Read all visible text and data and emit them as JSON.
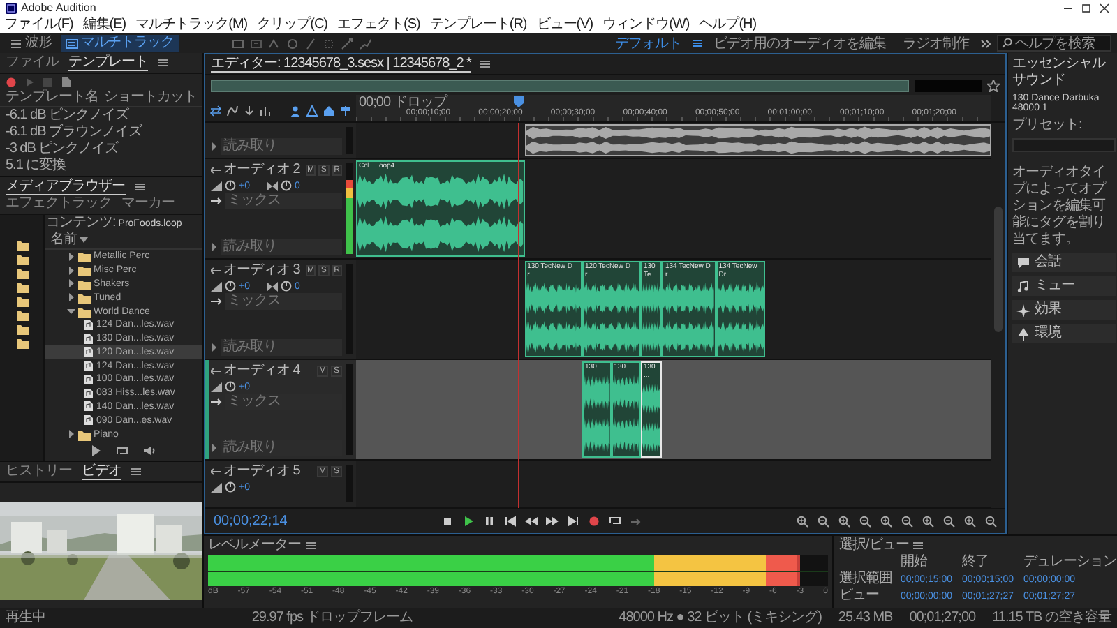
{
  "window": {
    "title": "Adobe Audition"
  },
  "menu": [
    "ファイル(F)",
    "編集(E)",
    "マルチトラック(M)",
    "クリップ(C)",
    "エフェクト(S)",
    "テンプレート(R)",
    "ビュー(V)",
    "ウィンドウ(W)",
    "ヘルプ(H)"
  ],
  "modes": [
    {
      "label": "波形",
      "selected": false
    },
    {
      "label": "マルチトラック",
      "selected": true
    }
  ],
  "workspaces": [
    {
      "label": "デフォルト",
      "selected": true
    },
    {
      "label": "ビデオ用のオーディオを編集",
      "selected": false
    },
    {
      "label": "ラジオ制作",
      "selected": false
    }
  ],
  "help_search": {
    "placeholder": "ヘルプを検索"
  },
  "templates_panel": {
    "tabs": [
      {
        "label": "ファイル",
        "selected": false
      },
      {
        "label": "テンプレート",
        "selected": true
      }
    ],
    "columns": [
      "テンプレート名",
      "ショートカット"
    ],
    "rows": [
      "-6.1 dB ピンクノイズ",
      "-6.1 dB ブラウンノイズ",
      "-3 dB ピンクノイズ",
      "5.1 に変換"
    ]
  },
  "media_browser": {
    "tabs": [
      {
        "label": "メディアブラウザー",
        "selected": true
      },
      {
        "label": "エフェクトラック",
        "selected": false
      },
      {
        "label": "マーカー",
        "selected": false
      }
    ],
    "content_label": "コンテンツ:",
    "content_value": "ProFoods.loop",
    "name_column": "名前",
    "items": [
      {
        "kind": "folder",
        "name": "Metallic Perc",
        "expanded": false,
        "selected": false
      },
      {
        "kind": "folder",
        "name": "Misc Perc",
        "expanded": false,
        "selected": false
      },
      {
        "kind": "folder",
        "name": "Shakers",
        "expanded": false,
        "selected": false
      },
      {
        "kind": "folder",
        "name": "Tuned",
        "expanded": false,
        "selected": false
      },
      {
        "kind": "folder",
        "name": "World Dance",
        "expanded": true,
        "selected": false,
        "children": [
          {
            "kind": "file",
            "name": "124 Dan...les.wav",
            "selected": false
          },
          {
            "kind": "file",
            "name": "130 Dan...les.wav",
            "selected": false
          },
          {
            "kind": "file",
            "name": "120 Dan...les.wav",
            "selected": true
          },
          {
            "kind": "file",
            "name": "124 Dan...les.wav",
            "selected": false
          },
          {
            "kind": "file",
            "name": "100 Dan...les.wav",
            "selected": false
          },
          {
            "kind": "file",
            "name": "083 Hiss...les.wav",
            "selected": false
          },
          {
            "kind": "file",
            "name": "140 Dan...les.wav",
            "selected": false
          },
          {
            "kind": "file",
            "name": "090 Dan...es.wav",
            "selected": false
          }
        ]
      },
      {
        "kind": "folder",
        "name": "Piano",
        "expanded": false,
        "selected": false
      }
    ]
  },
  "video_panel": {
    "tabs": [
      {
        "label": "ヒストリー",
        "selected": false
      },
      {
        "label": "ビデオ",
        "selected": true
      }
    ]
  },
  "editor": {
    "tab": "エディター: 12345678_3.sesx | 12345678_2 *",
    "timecode_format": "00;00 ドロップ",
    "ruler": [
      "00;00;10;00",
      "00;00;20;00",
      "00;00;30;00",
      "00;00;40;00",
      "00;00;50;00",
      "00;01;00;00",
      "00;01;10;00",
      "00;01;20;00"
    ],
    "timecode": "00;00;22;14",
    "tracks": [
      {
        "selected": false,
        "automation": "読み取り",
        "clips": [
          {
            "color": "#a9a9a9",
            "selected": false
          }
        ]
      },
      {
        "name": "オーディオ 2",
        "selected": false,
        "buttons": [
          "M",
          "S",
          "R"
        ],
        "volume": "+0",
        "pan": "0",
        "output": "ミックス",
        "automation": "読み取り",
        "level": 0.82,
        "clips": [
          {
            "name": "Cdl...Loop4",
            "color": "#3fbf8f",
            "selected": false
          }
        ]
      },
      {
        "name": "オーディオ 3",
        "selected": false,
        "buttons": [
          "M",
          "S",
          "R"
        ],
        "volume": "+0",
        "pan": "0",
        "output": "ミックス",
        "automation": "読み取り",
        "clips": [
          {
            "name": "130 TecNew Dr...",
            "color": "#3fbf8f",
            "selected": false
          },
          {
            "name": "120 TecNew Dr...",
            "color": "#3fbf8f",
            "selected": false
          },
          {
            "name": "130 Te...",
            "color": "#3fbf8f",
            "selected": false
          },
          {
            "name": "134 TecNew Dr...",
            "color": "#3fbf8f",
            "selected": false
          },
          {
            "name": "134 TecNew Dr...",
            "color": "#3fbf8f",
            "selected": false
          }
        ]
      },
      {
        "name": "オーディオ 4",
        "selected": true,
        "buttons": [
          "M",
          "S"
        ],
        "volume": "+0",
        "output": "ミックス",
        "automation": "読み取り",
        "clips": [
          {
            "name": "130...",
            "color": "#3fbf8f",
            "selected": false
          },
          {
            "name": "130...",
            "color": "#3fbf8f",
            "selected": false
          },
          {
            "name": "130 ...",
            "color": "#3fbf8f",
            "selected": true
          }
        ]
      },
      {
        "name": "オーディオ 5",
        "selected": false,
        "buttons": [
          "M",
          "S"
        ],
        "volume": "+0"
      }
    ]
  },
  "essential_sound": {
    "title": "エッセンシャルサウンド",
    "clip": "130 Dance Darbuka 48000 1",
    "preset_label": "プリセット:",
    "hint": "オーディオタイプによってオプションを編集可能にタグを割り当てます。",
    "types": [
      "会話",
      "ミュー",
      "効果",
      "環境"
    ]
  },
  "level_meter": {
    "title": "レベルメーター",
    "level": 0.955,
    "scale": [
      "dB",
      "-57",
      "-54",
      "-51",
      "-48",
      "-45",
      "-42",
      "-39",
      "-36",
      "-33",
      "-30",
      "-27",
      "-24",
      "-21",
      "-18",
      "-15",
      "-12",
      "-9",
      "-6",
      "-3",
      "0"
    ]
  },
  "selection_view": {
    "title": "選択/ビュー",
    "columns": [
      "開始",
      "終了",
      "デュレーション"
    ],
    "rows": [
      {
        "label": "選択範囲",
        "start": "00;00;15;00",
        "end": "00;00;15;00",
        "duration": "00;00;00;00"
      },
      {
        "label": "ビュー",
        "start": "00;00;00;00",
        "end": "00;01;27;27",
        "duration": "00;01;27;27"
      }
    ]
  },
  "status_bar": {
    "left": "再生中",
    "center": "29.97 fps ドロップフレーム",
    "items": [
      "48000 Hz ● 32 ビット (ミキシング)",
      "25.43 MB",
      "00;01;27;00",
      "11.15 TB の空き容量"
    ]
  }
}
